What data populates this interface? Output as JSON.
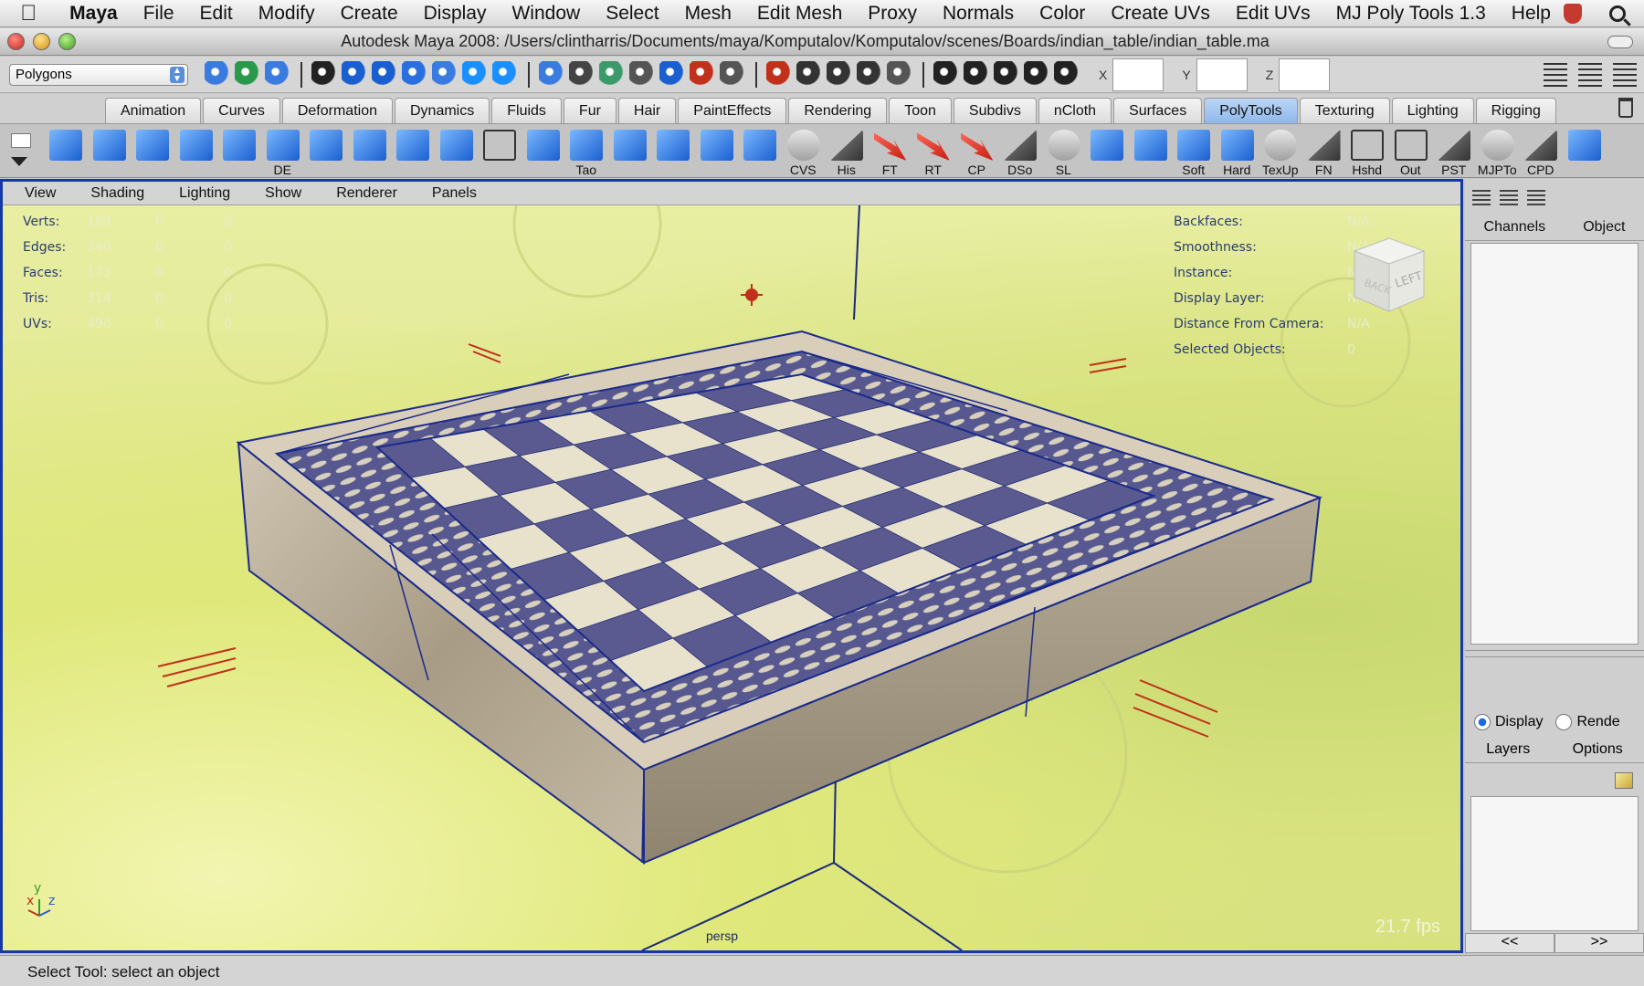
{
  "menubar": {
    "items": [
      {
        "label": "Maya",
        "bold": true
      },
      {
        "label": "File"
      },
      {
        "label": "Edit"
      },
      {
        "label": "Modify"
      },
      {
        "label": "Create"
      },
      {
        "label": "Display"
      },
      {
        "label": "Window"
      },
      {
        "label": "Select"
      },
      {
        "label": "Mesh"
      },
      {
        "label": "Edit Mesh"
      },
      {
        "label": "Proxy"
      },
      {
        "label": "Normals"
      },
      {
        "label": "Color"
      },
      {
        "label": "Create UVs"
      },
      {
        "label": "Edit UVs"
      },
      {
        "label": "MJ Poly Tools 1.3"
      },
      {
        "label": "Help"
      }
    ]
  },
  "window": {
    "title": "Autodesk Maya 2008: /Users/clintharris/Documents/maya/Komputalov/Komputalov/scenes/Boards/indian_table/indian_table.ma"
  },
  "statusline": {
    "mode": "Polygons",
    "xyz_labels": [
      "X",
      "Y",
      "Z"
    ]
  },
  "shelf_tabs": [
    {
      "label": "Animation"
    },
    {
      "label": "Curves"
    },
    {
      "label": "Deformation"
    },
    {
      "label": "Dynamics"
    },
    {
      "label": "Fluids"
    },
    {
      "label": "Fur"
    },
    {
      "label": "Hair"
    },
    {
      "label": "PaintEffects"
    },
    {
      "label": "Rendering"
    },
    {
      "label": "Toon"
    },
    {
      "label": "Subdivs"
    },
    {
      "label": "nCloth"
    },
    {
      "label": "Surfaces"
    },
    {
      "label": "PolyTools",
      "active": true
    },
    {
      "label": "Texturing"
    },
    {
      "label": "Lighting"
    },
    {
      "label": "Rigging"
    }
  ],
  "shelf_items": [
    {
      "label": "",
      "kind": "blue"
    },
    {
      "label": "",
      "kind": "blue"
    },
    {
      "label": "",
      "kind": "blue"
    },
    {
      "label": "",
      "kind": "blue"
    },
    {
      "label": "",
      "kind": "blue"
    },
    {
      "label": "DE",
      "kind": "blue"
    },
    {
      "label": "",
      "kind": "blue"
    },
    {
      "label": "",
      "kind": "blue"
    },
    {
      "label": "",
      "kind": "blue"
    },
    {
      "label": "",
      "kind": "blue"
    },
    {
      "label": "",
      "kind": "wire"
    },
    {
      "label": "",
      "kind": "blue"
    },
    {
      "label": "Tao",
      "kind": "blue"
    },
    {
      "label": "",
      "kind": "blue"
    },
    {
      "label": "",
      "kind": "blue"
    },
    {
      "label": "",
      "kind": "blue"
    },
    {
      "label": "",
      "kind": "blue"
    },
    {
      "label": "CVS",
      "kind": "mel"
    },
    {
      "label": "His",
      "kind": "grey"
    },
    {
      "label": "FT",
      "kind": "red"
    },
    {
      "label": "RT",
      "kind": "red"
    },
    {
      "label": "CP",
      "kind": "red"
    },
    {
      "label": "DSo",
      "kind": "grey"
    },
    {
      "label": "SL",
      "kind": "mel"
    },
    {
      "label": "",
      "kind": "blue"
    },
    {
      "label": "",
      "kind": "blue"
    },
    {
      "label": "Soft",
      "kind": "blue"
    },
    {
      "label": "Hard",
      "kind": "blue"
    },
    {
      "label": "TexUp",
      "kind": "mel"
    },
    {
      "label": "FN",
      "kind": "grey"
    },
    {
      "label": "Hshd",
      "kind": "wire"
    },
    {
      "label": "Out",
      "kind": "wire"
    },
    {
      "label": "PST",
      "kind": "grey"
    },
    {
      "label": "MJPTo",
      "kind": "mel"
    },
    {
      "label": "CPD",
      "kind": "grey"
    },
    {
      "label": "",
      "kind": "blue"
    }
  ],
  "panel_menu": [
    "View",
    "Shading",
    "Lighting",
    "Show",
    "Renderer",
    "Panels"
  ],
  "hud_stats": [
    {
      "label": "Verts:",
      "values": [
        "169",
        "0",
        "0"
      ]
    },
    {
      "label": "Edges:",
      "values": [
        "340",
        "0",
        "0"
      ]
    },
    {
      "label": "Faces:",
      "values": [
        "173",
        "0",
        "0"
      ]
    },
    {
      "label": "Tris:",
      "values": [
        "314",
        "0",
        "0"
      ]
    },
    {
      "label": "UVs:",
      "values": [
        "496",
        "0",
        "0"
      ]
    }
  ],
  "hud_right": [
    {
      "label": "Backfaces:",
      "value": "N/A"
    },
    {
      "label": "Smoothness:",
      "value": "N/A"
    },
    {
      "label": "Instance:",
      "value": "N/A"
    },
    {
      "label": "Display Layer:",
      "value": "N/A"
    },
    {
      "label": "Distance From Camera:",
      "value": "N/A"
    },
    {
      "label": "Selected Objects:",
      "value": "0"
    }
  ],
  "viewcube": {
    "left_label": "LEFT",
    "back_label": "BACK"
  },
  "viewport": {
    "camera": "persp",
    "fps": "21.7 fps",
    "axis": {
      "x": "x",
      "y": "y",
      "z": "z"
    }
  },
  "channel_box": {
    "headers": [
      "Channels",
      "Object"
    ],
    "radio_display": "Display",
    "radio_render": "Rende",
    "layers_menu": [
      "Layers",
      "Options"
    ],
    "nav_prev": "<<",
    "nav_next": ">>"
  },
  "helpline": {
    "text": "Select Tool: select an object"
  },
  "colors": {
    "viewport_border": "#1438a8",
    "active_tab": "#8fb7ea",
    "board_purple": "#5b5a90",
    "board_cream": "#e8e2cc",
    "marble": "#b9ad98"
  }
}
